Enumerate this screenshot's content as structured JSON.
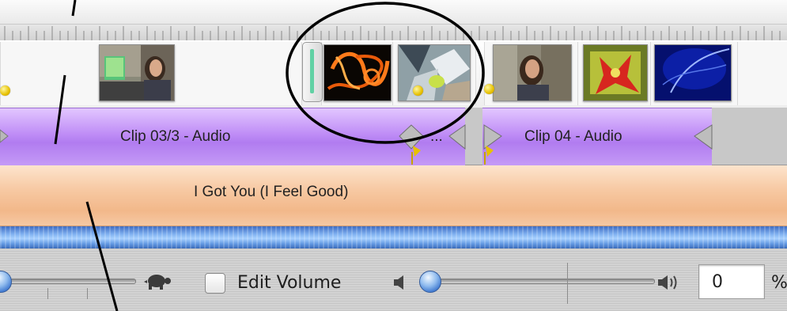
{
  "timeline": {
    "audio_track": {
      "clips": [
        {
          "label": "Clip 03/3 - Audio",
          "color": "#bf8df6"
        },
        {
          "label": "...",
          "color": "#bf8df6"
        },
        {
          "label": "Clip 04 - Audio",
          "color": "#bf8df6"
        }
      ]
    },
    "music_track": {
      "label": "I Got You (I Feel Good)",
      "color": "#f2b88a"
    }
  },
  "controls": {
    "zoom_icon": "turtle-icon",
    "edit_volume_label": "Edit Volume",
    "edit_volume_checked": false,
    "volume_low_icon": "speaker-low-icon",
    "volume_high_icon": "speaker-high-icon",
    "volume_level": 0.0,
    "volume_percent_value": "0",
    "volume_percent_sign": "%"
  },
  "colors": {
    "accent_blue": "#2d69c8",
    "transition_handle": "#61d1a4",
    "annotation": "#000000"
  }
}
